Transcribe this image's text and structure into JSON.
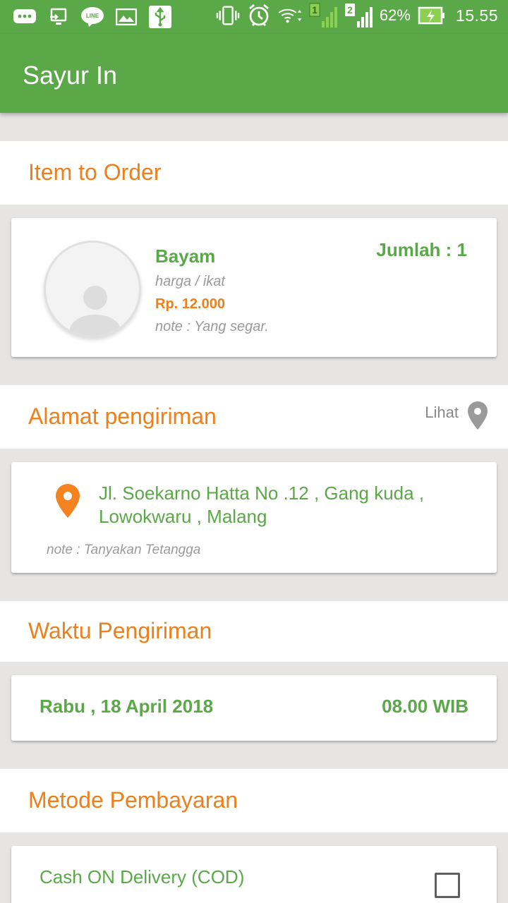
{
  "status_bar": {
    "battery": "62%",
    "time": "15.55",
    "sim1": "1",
    "sim2": "2",
    "icons": [
      "chat-bubble-icon",
      "cast-icon",
      "line-app-icon",
      "image-icon",
      "usb-icon",
      "vibrate-icon",
      "alarm-icon",
      "wifi-icon",
      "signal-icon",
      "battery-charging-icon"
    ]
  },
  "app": {
    "title": "Sayur In"
  },
  "item_section": {
    "title": "Item to Order",
    "item": {
      "name": "Bayam",
      "unit": "harga / ikat",
      "price": "Rp. 12.000",
      "note": "note : Yang segar.",
      "quantity": "Jumlah : 1"
    }
  },
  "address_section": {
    "title": "Alamat pengiriman",
    "view_label": "Lihat",
    "address_line1": "Jl. Soekarno Hatta No .12 , Gang kuda ,",
    "address_line2": "Lowokwaru , Malang",
    "note": "note : Tanyakan Tetangga"
  },
  "time_section": {
    "title": "Waktu Pengiriman",
    "date": "Rabu , 18 April 2018",
    "time": "08.00 WIB"
  },
  "payment_section": {
    "title": "Metode Pembayaran",
    "option_label": "Cash ON Delivery (COD)",
    "option_checked": false
  },
  "colors": {
    "primary_green": "#5aa847",
    "accent_orange": "#ee7f1a",
    "background": "#e6e5e3"
  }
}
